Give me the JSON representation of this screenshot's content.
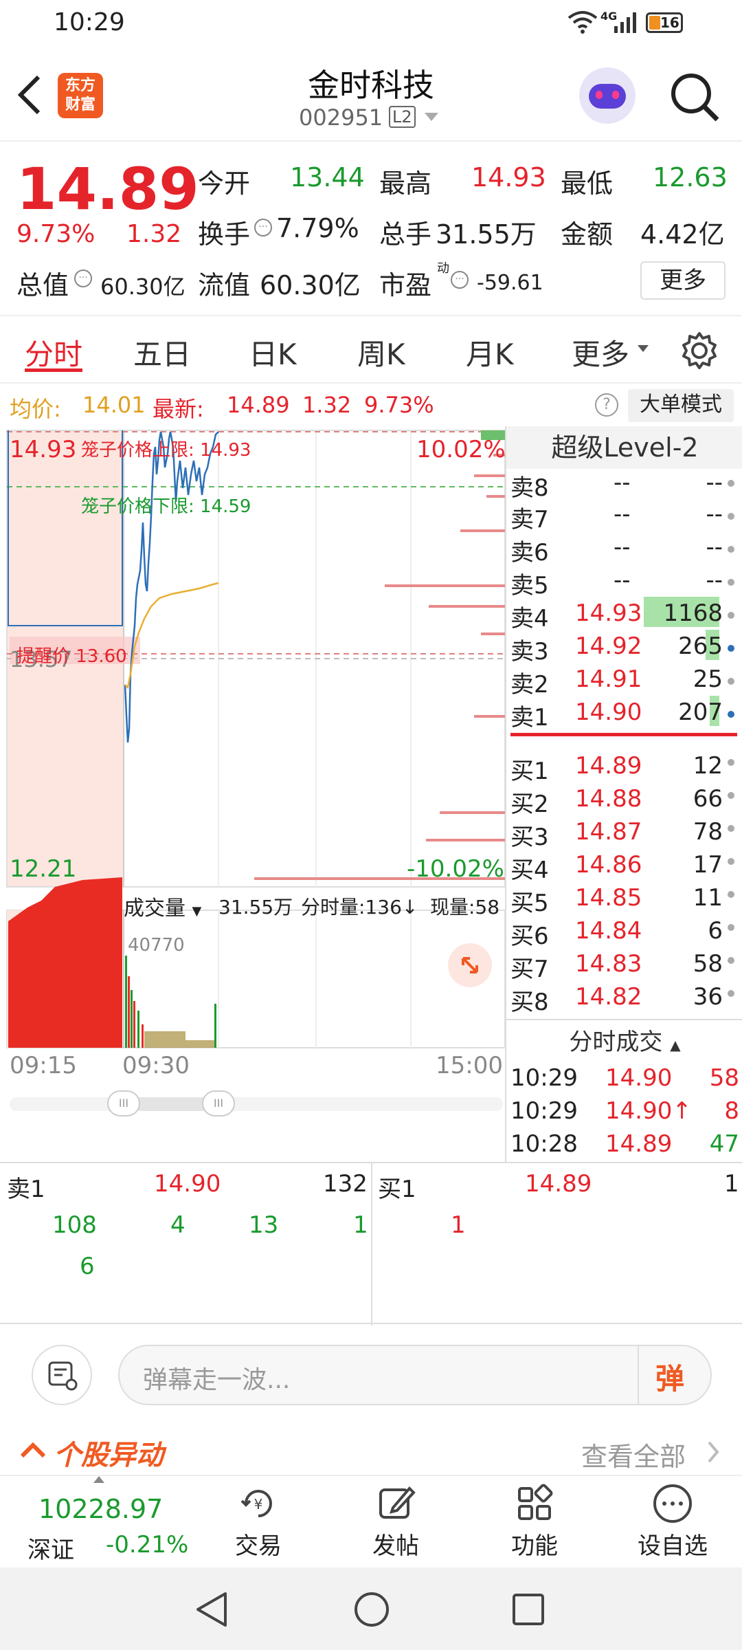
{
  "status": {
    "time": "10:29",
    "network": "4G",
    "battery": "16"
  },
  "header": {
    "app_logo": "东方\n财富",
    "title": "金时科技",
    "code": "002951",
    "level": "L2"
  },
  "quote": {
    "price": "14.89",
    "pct": "9.73%",
    "chg": "1.32",
    "open_label": "今开",
    "open": "13.44",
    "high_label": "最高",
    "high": "14.93",
    "low_label": "最低",
    "low": "12.63",
    "turnover_label": "换手",
    "turnover": "7.79%",
    "volume_label": "总手",
    "volume": "31.55万",
    "amount_label": "金额",
    "amount": "4.42亿",
    "mcap_label": "总值",
    "mcap": "60.30亿",
    "float_label": "流值",
    "float": "60.30亿",
    "pe_label": "市盈",
    "pe_sup": "动",
    "pe": "-59.61",
    "more_btn": "更多"
  },
  "tabs": [
    "分时",
    "五日",
    "日K",
    "周K",
    "月K",
    "更多"
  ],
  "info_line": {
    "avg_label": "均价:",
    "avg": "14.01",
    "latest_label": "最新:",
    "latest": "14.89",
    "chg": "1.32",
    "pct": "9.73%",
    "big_order": "大单模式"
  },
  "chart": {
    "top_price": "14.93",
    "bottom_price": "12.21",
    "mid_price": "13.57",
    "top_pct": "10.02%",
    "bottom_pct": "-10.02%",
    "cage_upper": "笼子价格上限: 14.93",
    "cage_lower": "笼子价格下限: 14.59",
    "alert_price": "提醒价 13.60",
    "vol_label": "成交量",
    "vol_total": "31.55万",
    "minute_vol": "分时量:136↓",
    "current_vol": "现量:58",
    "vol_max": "40770",
    "time_start": "09:15",
    "time_mid": "09:30",
    "time_end": "15:00"
  },
  "level2": {
    "title": "超级Level-2",
    "asks": [
      {
        "label": "卖8",
        "price": "--",
        "vol": "--"
      },
      {
        "label": "卖7",
        "price": "--",
        "vol": "--"
      },
      {
        "label": "卖6",
        "price": "--",
        "vol": "--"
      },
      {
        "label": "卖5",
        "price": "--",
        "vol": "--"
      },
      {
        "label": "卖4",
        "price": "14.93",
        "vol": "1168"
      },
      {
        "label": "卖3",
        "price": "14.92",
        "vol": "265"
      },
      {
        "label": "卖2",
        "price": "14.91",
        "vol": "25"
      },
      {
        "label": "卖1",
        "price": "14.90",
        "vol": "207"
      }
    ],
    "bids": [
      {
        "label": "买1",
        "price": "14.89",
        "vol": "12"
      },
      {
        "label": "买2",
        "price": "14.88",
        "vol": "66"
      },
      {
        "label": "买3",
        "price": "14.87",
        "vol": "78"
      },
      {
        "label": "买4",
        "price": "14.86",
        "vol": "17"
      },
      {
        "label": "买5",
        "price": "14.85",
        "vol": "11"
      },
      {
        "label": "买6",
        "price": "14.84",
        "vol": "6"
      },
      {
        "label": "买7",
        "price": "14.83",
        "vol": "58"
      },
      {
        "label": "买8",
        "price": "14.82",
        "vol": "36"
      }
    ],
    "trades_title": "分时成交",
    "trades": [
      {
        "time": "10:29",
        "price": "14.90",
        "vol": "58"
      },
      {
        "time": "10:29",
        "price": "14.90↑",
        "vol": "8"
      },
      {
        "time": "10:28",
        "price": "14.89",
        "vol": "47"
      }
    ]
  },
  "queue": {
    "sell_label": "卖1",
    "sell_price": "14.90",
    "sell_total": "132",
    "buy_label": "买1",
    "buy_price": "14.89",
    "buy_total": "1",
    "sell_orders": [
      "108",
      "4",
      "13",
      "1",
      "6"
    ],
    "buy_orders": [
      "1"
    ]
  },
  "danmu": {
    "placeholder": "弹幕走一波...",
    "send": "弹"
  },
  "alert": {
    "title": "个股异动",
    "view_all": "查看全部"
  },
  "bottom_nav": {
    "index_value": "10228.97",
    "index_name": "深证",
    "index_pct": "-0.21%",
    "trade": "交易",
    "post": "发帖",
    "func": "功能",
    "watch": "设自选"
  }
}
